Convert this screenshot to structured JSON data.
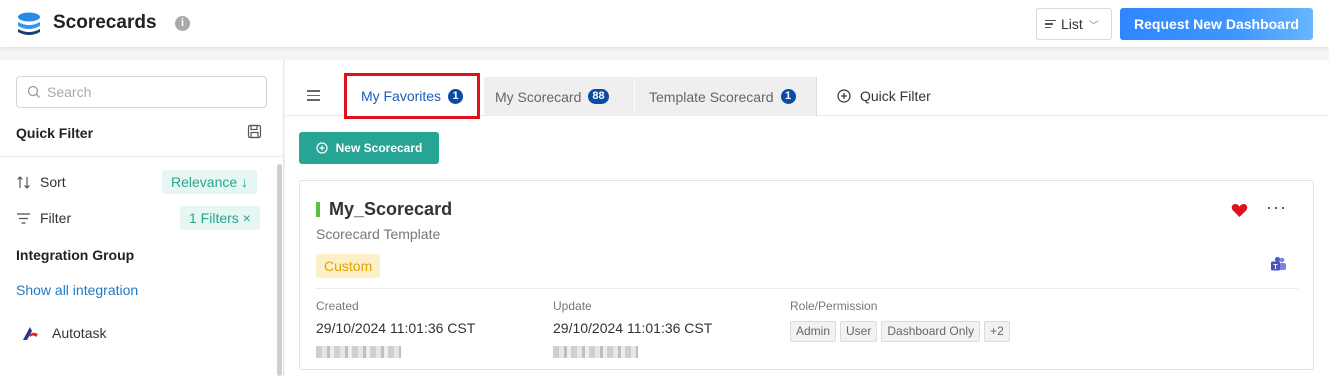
{
  "header": {
    "title": "Scorecards",
    "info_icon": "i",
    "view_label": "List",
    "request_button": "Request New Dashboard"
  },
  "sidebar": {
    "search_placeholder": "Search",
    "quick_filter_title": "Quick Filter",
    "sort_label": "Sort",
    "sort_value": "Relevance ↓",
    "filter_label": "Filter",
    "filter_value": "1 Filters ×",
    "integration_group_title": "Integration Group",
    "show_all_link": "Show all integration",
    "integrations": [
      {
        "label": "Autotask",
        "icon": "autotask-logo-icon"
      }
    ]
  },
  "main": {
    "tabs": [
      {
        "label": "My Favorites",
        "count": "1",
        "active": true
      },
      {
        "label": "My Scorecard",
        "count": "88",
        "active": false
      },
      {
        "label": "Template Scorecard",
        "count": "1",
        "active": false
      }
    ],
    "quick_filter_label": "Quick Filter",
    "new_button": "New Scorecard",
    "card": {
      "title": "My_Scorecard",
      "subtitle": "Scorecard Template",
      "tag": "Custom",
      "created_label": "Created",
      "created_value": "29/10/2024 11:01:36 CST",
      "update_label": "Update",
      "update_value": "29/10/2024 11:01:36 CST",
      "role_label": "Role/Permission",
      "roles": [
        "Admin",
        "User",
        "Dashboard Only",
        "+2"
      ],
      "favorite": true,
      "more_label": "···"
    }
  },
  "colors": {
    "primary_blue": "#2f86ff",
    "teal": "#26a595",
    "highlight_red": "#e0101c",
    "badge_blue": "#0b4aa8",
    "heart_red": "#e0101c",
    "tag_yellow": "#e3a200"
  }
}
